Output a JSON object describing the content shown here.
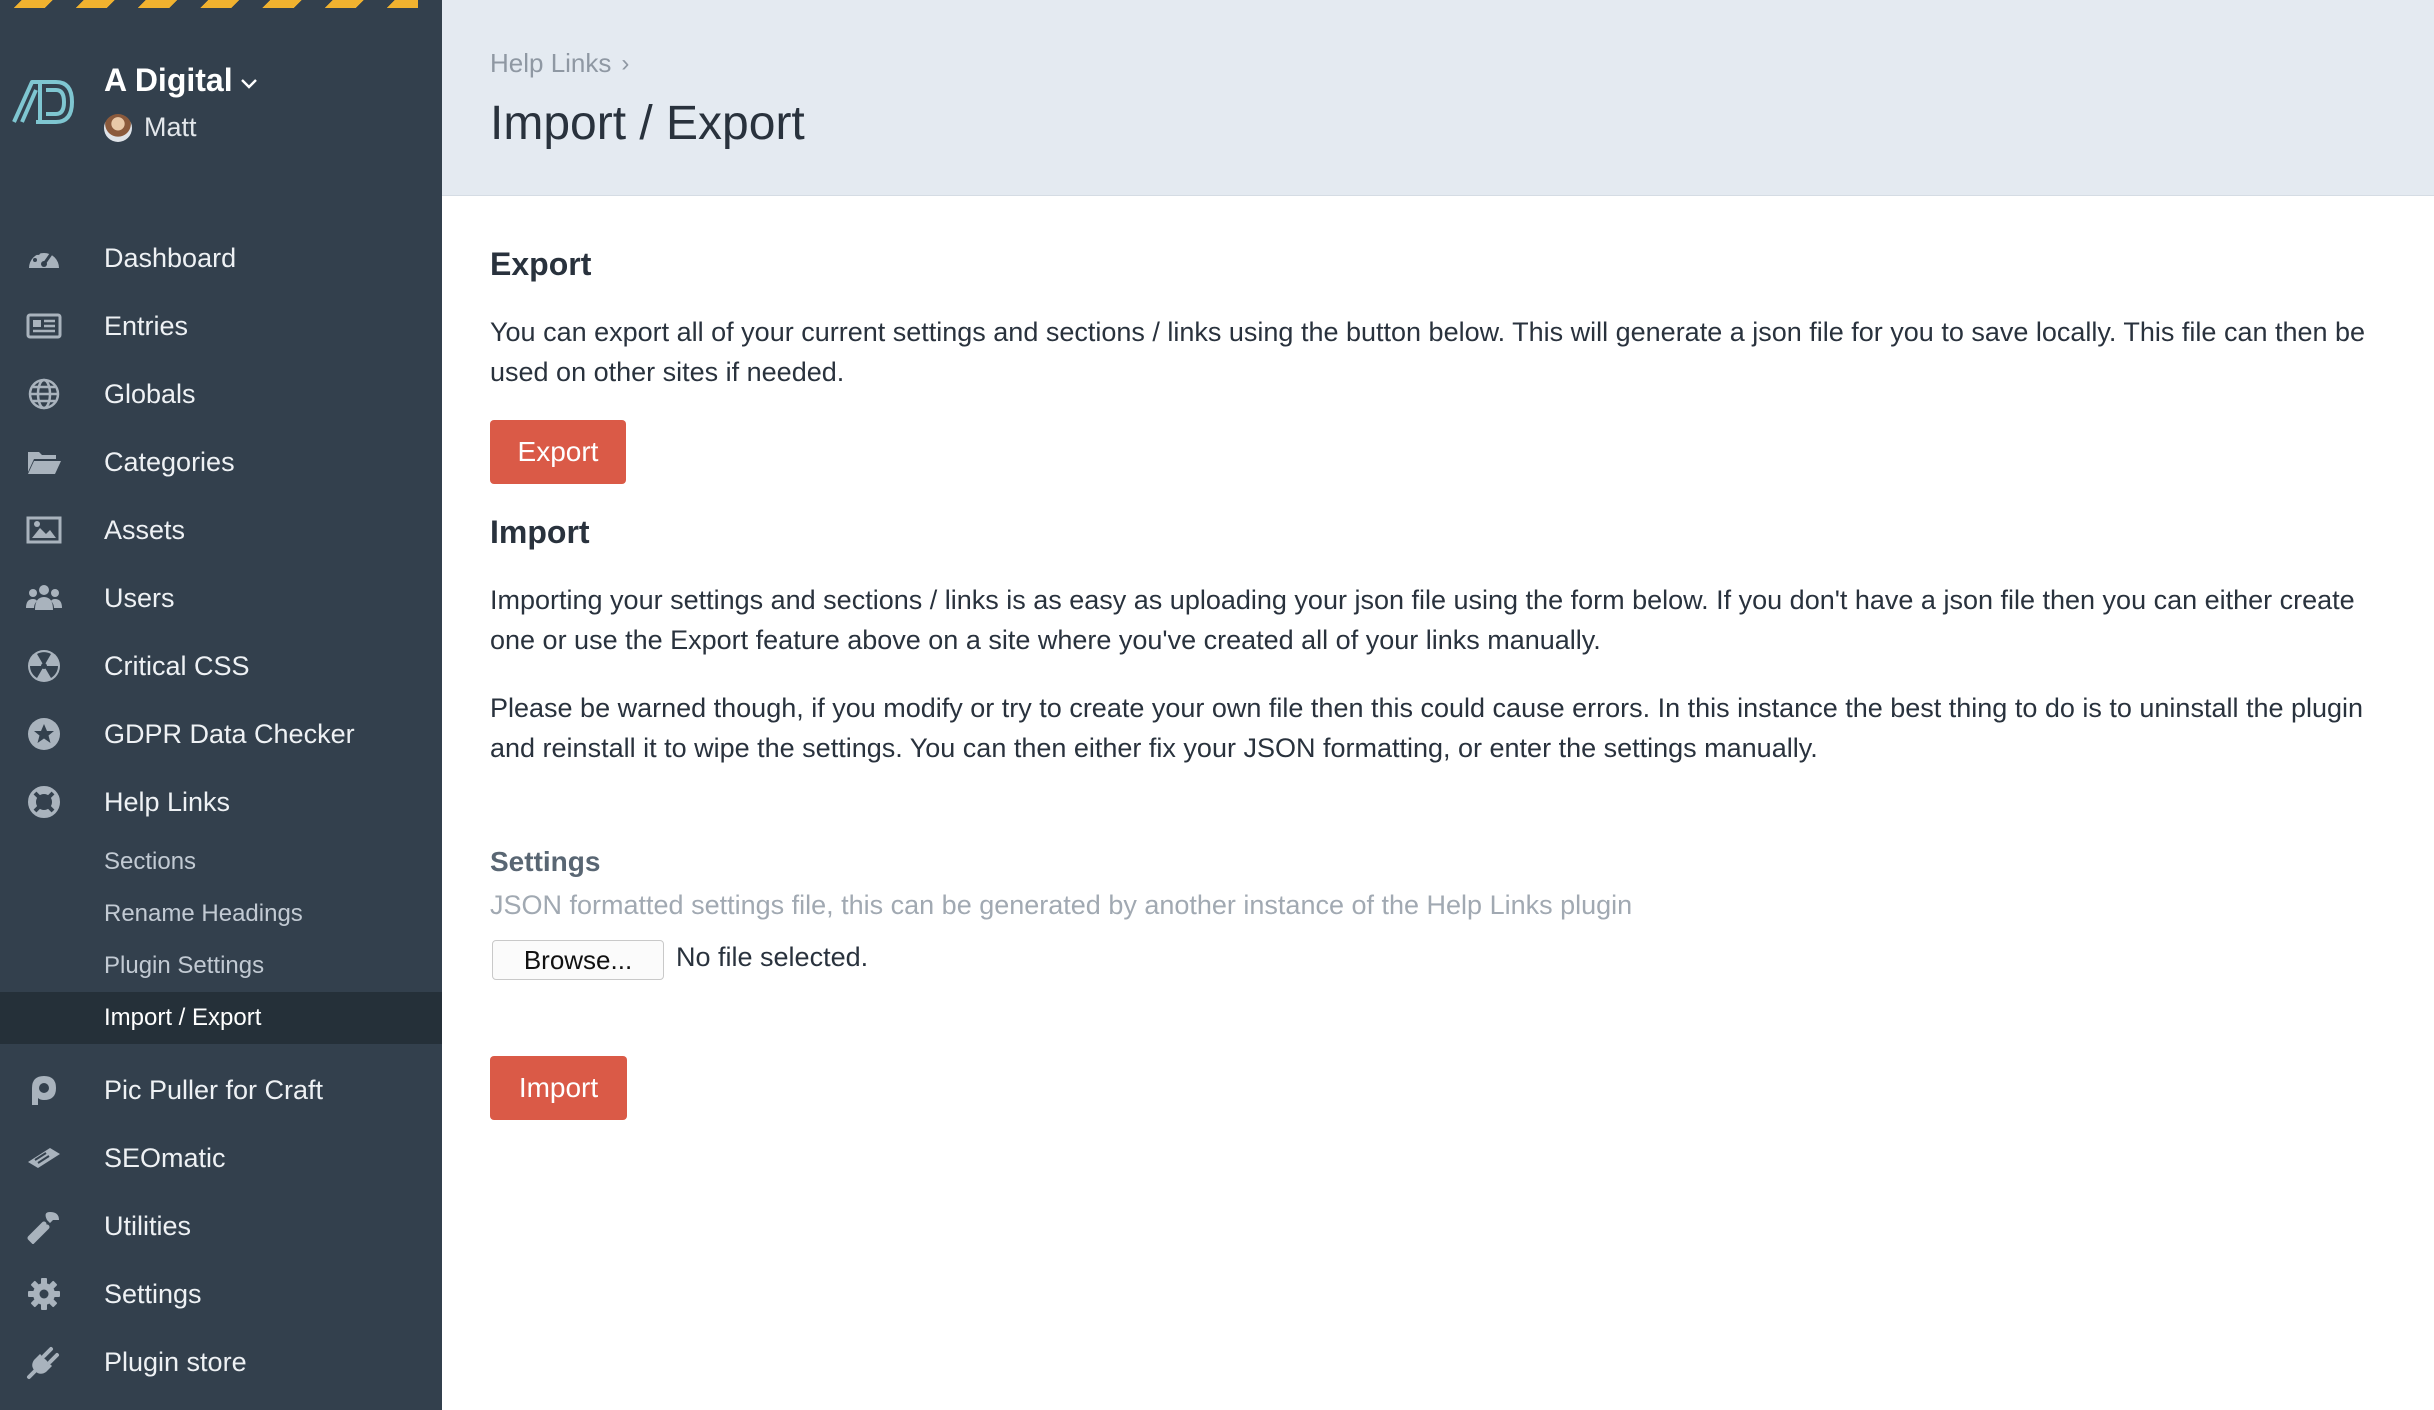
{
  "site": {
    "name": "A Digital",
    "user": "Matt"
  },
  "nav": {
    "items": [
      {
        "label": "Dashboard",
        "icon": "dashboard-icon"
      },
      {
        "label": "Entries",
        "icon": "entries-icon"
      },
      {
        "label": "Globals",
        "icon": "globe-icon"
      },
      {
        "label": "Categories",
        "icon": "folder-icon"
      },
      {
        "label": "Assets",
        "icon": "image-icon"
      },
      {
        "label": "Users",
        "icon": "users-icon"
      },
      {
        "label": "Critical CSS",
        "icon": "radiation-icon"
      },
      {
        "label": "GDPR Data Checker",
        "icon": "star-badge-icon"
      },
      {
        "label": "Help Links",
        "icon": "lifebuoy-icon"
      }
    ],
    "sub_items": [
      {
        "label": "Sections"
      },
      {
        "label": "Rename Headings"
      },
      {
        "label": "Plugin Settings"
      },
      {
        "label": "Import / Export",
        "active": true
      }
    ],
    "items_after": [
      {
        "label": "Pic Puller for Craft",
        "icon": "picpuller-icon"
      },
      {
        "label": "SEOmatic",
        "icon": "seomatic-icon"
      },
      {
        "label": "Utilities",
        "icon": "wrench-icon"
      },
      {
        "label": "Settings",
        "icon": "gear-icon"
      },
      {
        "label": "Plugin store",
        "icon": "plug-icon"
      }
    ]
  },
  "header": {
    "breadcrumb": "Help Links",
    "breadcrumb_sep": "›",
    "title": "Import / Export"
  },
  "export": {
    "heading": "Export",
    "text": "You can export all of your current settings and sections / links using the button below. This will generate a json file for you to save locally. This file can then be used on other sites if needed.",
    "button": "Export"
  },
  "import": {
    "heading": "Import",
    "text1": "Importing your settings and sections / links is as easy as uploading your json file using the form below. If you don't have a json file then you can either create one or use the Export feature above on a site where you've created all of your links manually.",
    "text2": "Please be warned though, if you modify or try to create your own file then this could cause errors. In this instance the best thing to do is to uninstall the plugin and reinstall it to wipe the settings. You can then either fix your JSON formatting, or enter the settings manually.",
    "settings_label": "Settings",
    "settings_hint": "JSON formatted settings file, this can be generated by another instance of the Help Links plugin",
    "browse_label": "Browse...",
    "file_status": "No file selected.",
    "button": "Import"
  },
  "colors": {
    "sidebar": "#33404d",
    "accent": "#da5a47",
    "header_bg": "#e4eaf1",
    "hazard": "#f1b22f"
  }
}
